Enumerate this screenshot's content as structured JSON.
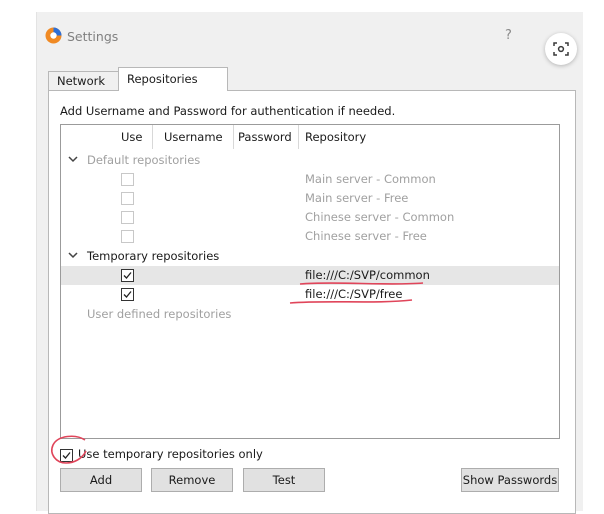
{
  "window": {
    "title": "Settings",
    "help": "?"
  },
  "tabs": [
    {
      "label": "Network"
    },
    {
      "label": "Repositories"
    }
  ],
  "panel": {
    "hint": "Add Username and Password for authentication if needed."
  },
  "tree": {
    "columns": [
      "Use",
      "Username",
      "Password",
      "Repository"
    ],
    "groups": [
      {
        "label": "Default repositories",
        "rows": [
          {
            "repository": "Main server - Common",
            "checked": false
          },
          {
            "repository": "Main server - Free",
            "checked": false
          },
          {
            "repository": "Chinese server - Common",
            "checked": false
          },
          {
            "repository": "Chinese server - Free",
            "checked": false
          }
        ]
      },
      {
        "label": "Temporary repositories",
        "rows": [
          {
            "repository": "file:///C:/SVP/common",
            "checked": true
          },
          {
            "repository": "file:///C:/SVP/free",
            "checked": true
          }
        ]
      }
    ],
    "user_defined_label": "User defined repositories"
  },
  "options": {
    "use_temp_only_label": "Use temporary repositories only",
    "use_temp_only_checked": true
  },
  "buttons": {
    "add": "Add",
    "remove": "Remove",
    "test": "Test",
    "show_passwords": "Show Passwords"
  },
  "colors": {
    "annotation_red": "#e0455a",
    "selected_row": "#e6e6e6",
    "app_icon_orange": "#f08a24",
    "app_icon_blue": "#2d6fd6"
  }
}
